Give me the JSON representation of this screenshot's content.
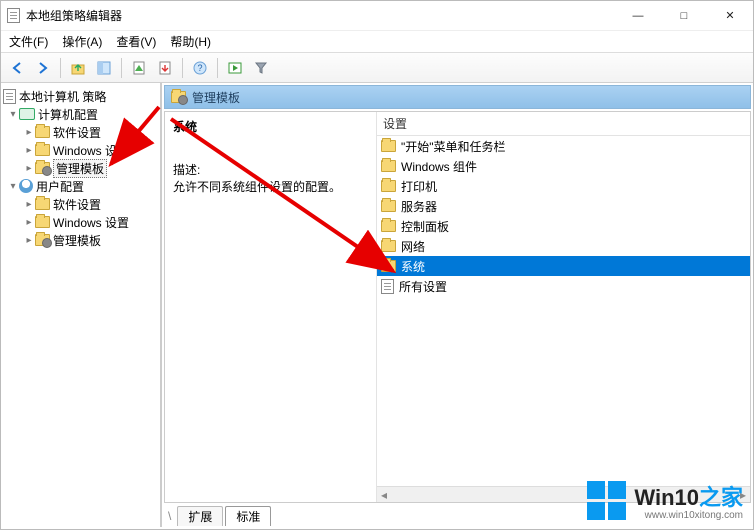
{
  "window": {
    "title": "本地组策略编辑器",
    "controls": {
      "min": "—",
      "max": "□",
      "close": "✕"
    }
  },
  "menu": {
    "file": "文件(F)",
    "action": "操作(A)",
    "view": "查看(V)",
    "help": "帮助(H)"
  },
  "tree": {
    "root": "本地计算机 策略",
    "computer": "计算机配置",
    "comp_children": {
      "software": "软件设置",
      "windows": "Windows 设置",
      "admin": "管理模板"
    },
    "user": "用户配置",
    "user_children": {
      "software": "软件设置",
      "windows": "Windows 设置",
      "admin": "管理模板"
    }
  },
  "detail": {
    "crumb": "管理模板",
    "heading": "系统",
    "desc_label": "描述:",
    "desc_text": "允许不同系统组件设置的配置。",
    "col_header": "设置",
    "items": [
      {
        "label": "\"开始\"菜单和任务栏",
        "type": "folder"
      },
      {
        "label": "Windows 组件",
        "type": "folder"
      },
      {
        "label": "打印机",
        "type": "folder"
      },
      {
        "label": "服务器",
        "type": "folder"
      },
      {
        "label": "控制面板",
        "type": "folder"
      },
      {
        "label": "网络",
        "type": "folder"
      },
      {
        "label": "系统",
        "type": "folder",
        "selected": true
      },
      {
        "label": "所有设置",
        "type": "settings"
      }
    ]
  },
  "tabs": {
    "extended": "扩展",
    "standard": "标准"
  },
  "watermark": {
    "brand_a": "Win10",
    "brand_b": "之家",
    "url": "www.win10xitong.com"
  }
}
